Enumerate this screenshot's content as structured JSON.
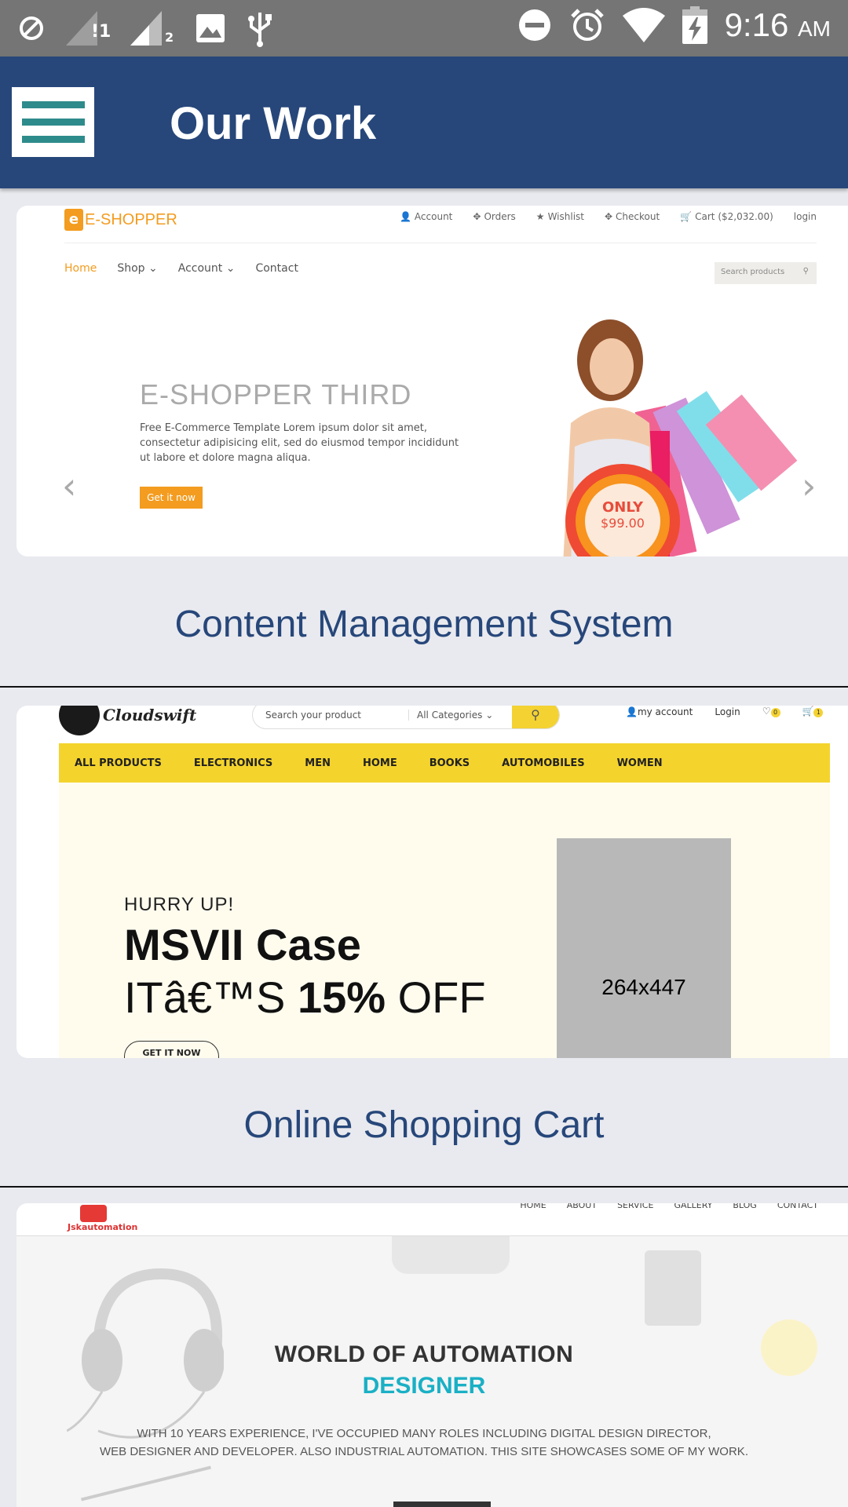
{
  "status_bar": {
    "time": "9:16",
    "ampm": "AM",
    "icons": [
      "blocked-icon",
      "signal-sim1-icon",
      "signal-sim2-icon",
      "image-icon",
      "usb-icon",
      "dnd-icon",
      "alarm-icon",
      "wifi-icon",
      "battery-charging-icon"
    ],
    "sim1": "!1",
    "sim2": "2"
  },
  "app_bar": {
    "title": "Our Work",
    "menu_icon": "hamburger-icon"
  },
  "portfolio": [
    {
      "caption": "Content Management System",
      "preview": {
        "logo": "E-SHOPPER",
        "top_nav": [
          "Account",
          "Orders",
          "Wishlist",
          "Checkout",
          "Cart ($2,032.00)",
          "login"
        ],
        "menu": [
          "Home",
          "Shop",
          "Account",
          "Contact"
        ],
        "search_placeholder": "Search products",
        "headline": "E-SHOPPER THIRD",
        "paragraph": "Free E-Commerce Template Lorem ipsum dolor sit amet, consectetur adipisicing elit, sed do eiusmod tempor incididunt ut labore et dolore magna aliqua.",
        "button": "Get it now",
        "badge_top": "ONLY",
        "badge_price": "$99.00"
      }
    },
    {
      "caption": "Online Shopping Cart",
      "preview": {
        "logo": "Cloudswift",
        "search_placeholder": "Search your product",
        "category": "All Categories",
        "account": "my account",
        "login": "Login",
        "wishlist_count": "0",
        "cart_count": "1",
        "nav": [
          "ALL PRODUCTS",
          "ELECTRONICS",
          "MEN",
          "HOME",
          "BOOKS",
          "AUTOMOBILES",
          "WOMEN"
        ],
        "eyebrow": "HURRY UP!",
        "title": "MSVII Case",
        "offer_prefix": "ITâ€™S",
        "offer_percent": "15%",
        "offer_suffix": "OFF",
        "cta": "GET IT NOW",
        "placeholder": "264x447"
      }
    },
    {
      "preview": {
        "logo": "Jskautomation",
        "nav": [
          "HOME",
          "ABOUT",
          "SERVICE",
          "GALLERY",
          "BLOG",
          "CONTACT"
        ],
        "title": "WORLD OF AUTOMATION",
        "subtitle": "DESIGNER",
        "desc_line1": "WITH 10 YEARS EXPERIENCE, I'VE OCCUPIED MANY ROLES INCLUDING DIGITAL DESIGN DIRECTOR,",
        "desc_line2": "WEB DESIGNER AND DEVELOPER. ALSO INDUSTRIAL AUTOMATION. THIS SITE SHOWCASES SOME OF MY WORK."
      }
    }
  ]
}
